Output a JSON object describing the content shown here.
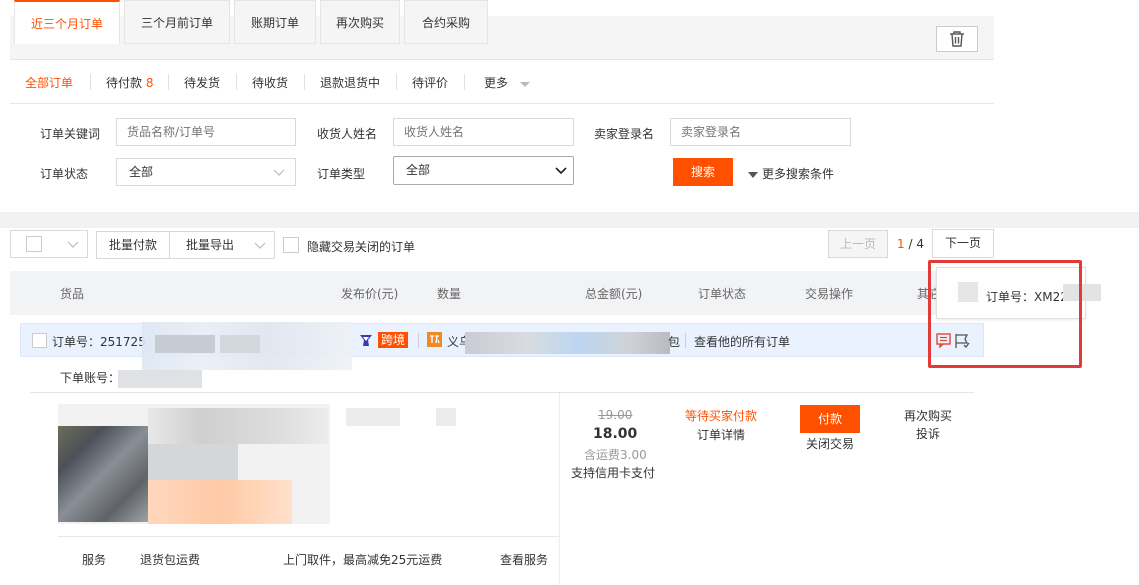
{
  "tabs": [
    "近三个月订单",
    "三个月前订单",
    "账期订单",
    "再次购买",
    "合约采购"
  ],
  "subnav": {
    "all": "全部订单",
    "pending_pay": "待付款",
    "pending_pay_count": "8",
    "pending_ship": "待发货",
    "pending_receive": "待收货",
    "refund": "退款退货中",
    "pending_review": "待评价",
    "more": "更多"
  },
  "search": {
    "keyword_label": "订单关键词",
    "keyword_placeholder": "货品名称/订单号",
    "receiver_label": "收货人姓名",
    "receiver_placeholder": "收货人姓名",
    "seller_label": "卖家登录名",
    "seller_placeholder": "卖家登录名",
    "status_label": "订单状态",
    "status_value": "全部",
    "type_label": "订单类型",
    "type_value": "全部",
    "search_button": "搜索",
    "more_conditions": "更多搜索条件"
  },
  "toolbar": {
    "batch_pay": "批量付款",
    "batch_export": "批量导出",
    "hide_closed": "隐藏交易关闭的订单",
    "prev_page": "上一页",
    "page_current": "1",
    "page_total": "/ 4",
    "next_page": "下一页"
  },
  "table_headers": [
    "货品",
    "发布价(元)",
    "数量",
    "总金额(元)",
    "订单状态",
    "交易操作",
    "其它"
  ],
  "order": {
    "order_no_label": "订单号：",
    "order_no_prefix": "251725",
    "crossborder_badge": "跨境",
    "shop_prefix": "义乌",
    "shop_suffix": "包",
    "view_all_orders": "查看他的所有订单",
    "account_label": "下单账号：",
    "original_price": "19.00",
    "total": "18.00",
    "shipping": "含运费3.00",
    "credit_card": "支持信用卡支付",
    "status": "等待买家付款",
    "order_detail": "订单详情",
    "pay_button": "付款",
    "close_trade": "关闭交易",
    "buy_again": "再次购买",
    "complain": "投诉"
  },
  "service_row": {
    "service": "服务",
    "return_shipping": "退货包运费",
    "pickup": "上门取件，最高减免25元运费",
    "view_service": "查看服务"
  },
  "tooltip": {
    "label": "订单号：XM22"
  },
  "colors": {
    "accent": "#ff5000",
    "highlight_box": "#e03b36",
    "order_row_bg": "#eaf2ff"
  },
  "icons": [
    "trash-icon",
    "chevron-down-icon",
    "caret-down-icon",
    "crossborder-icon",
    "shop-icon",
    "memo-icon",
    "flag-icon"
  ]
}
